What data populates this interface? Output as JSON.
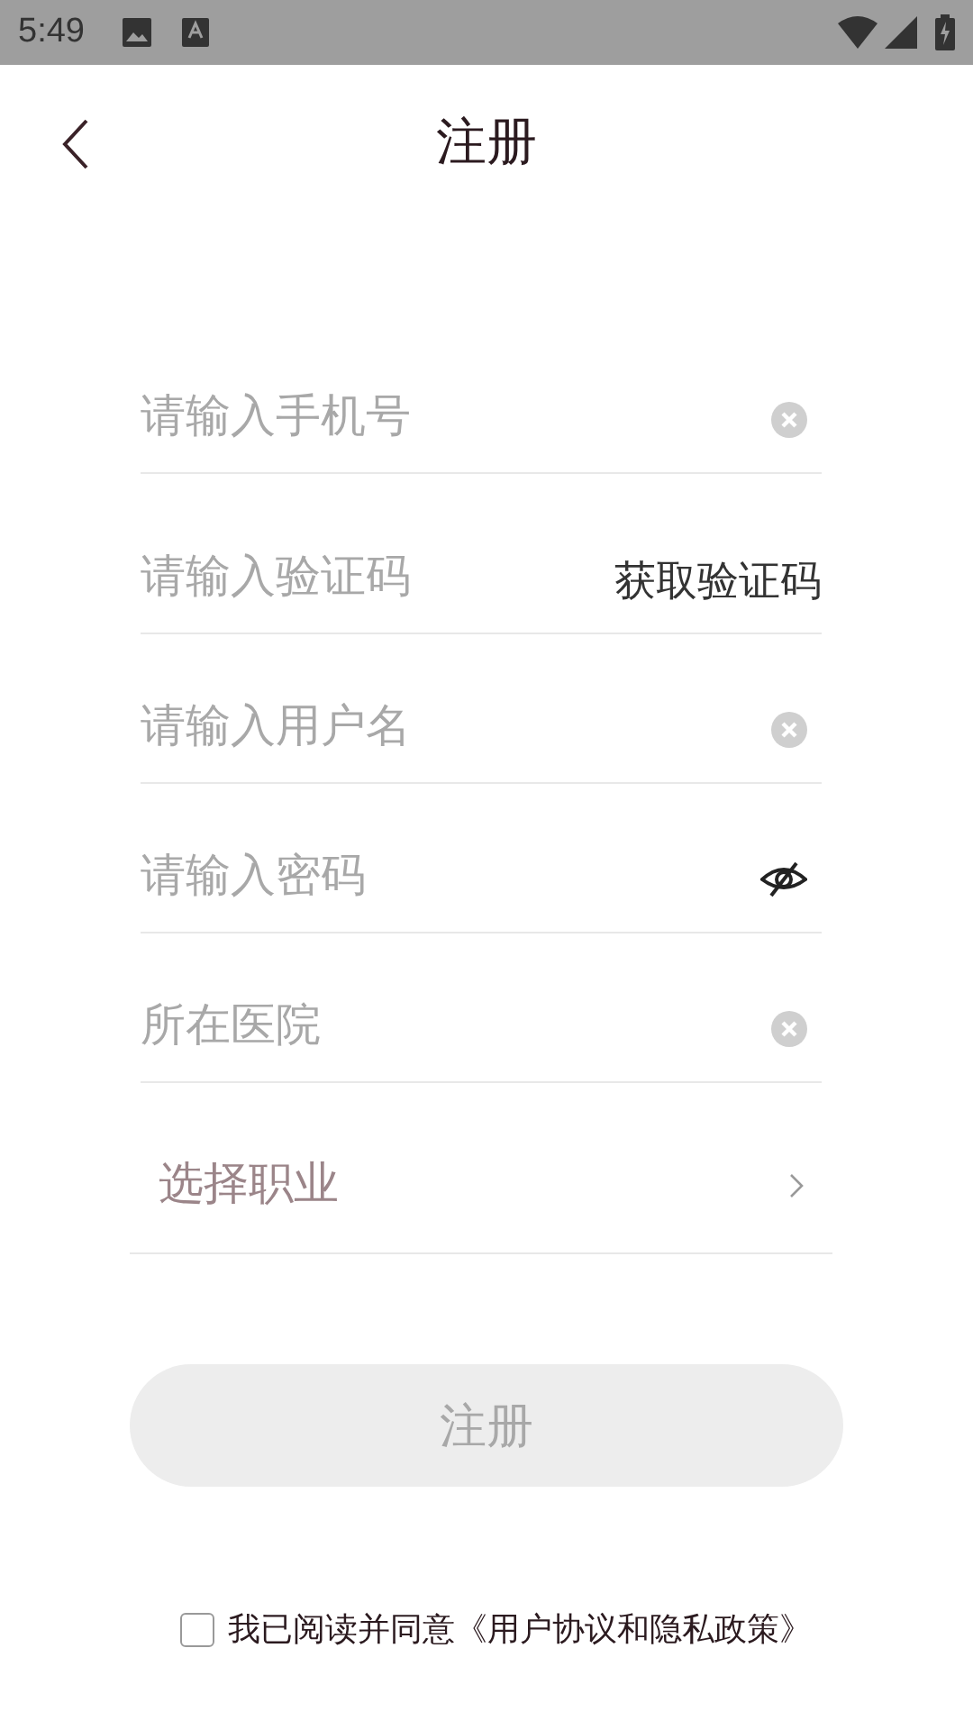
{
  "status_bar": {
    "time": "5:49"
  },
  "header": {
    "title": "注册"
  },
  "fields": [
    {
      "kind": "clear",
      "placeholder": "请输入手机号"
    },
    {
      "kind": "code",
      "placeholder": "请输入验证码",
      "action": "获取验证码"
    },
    {
      "kind": "clear",
      "placeholder": "请输入用户名"
    },
    {
      "kind": "password",
      "placeholder": "请输入密码"
    },
    {
      "kind": "clear",
      "placeholder": "所在医院"
    }
  ],
  "occupation_select": {
    "label": "选择职业"
  },
  "register_button": {
    "label": "注册",
    "disabled": true
  },
  "agreement": {
    "checked": false,
    "text": "我已阅读并同意《用户协议和隐私政策》"
  }
}
